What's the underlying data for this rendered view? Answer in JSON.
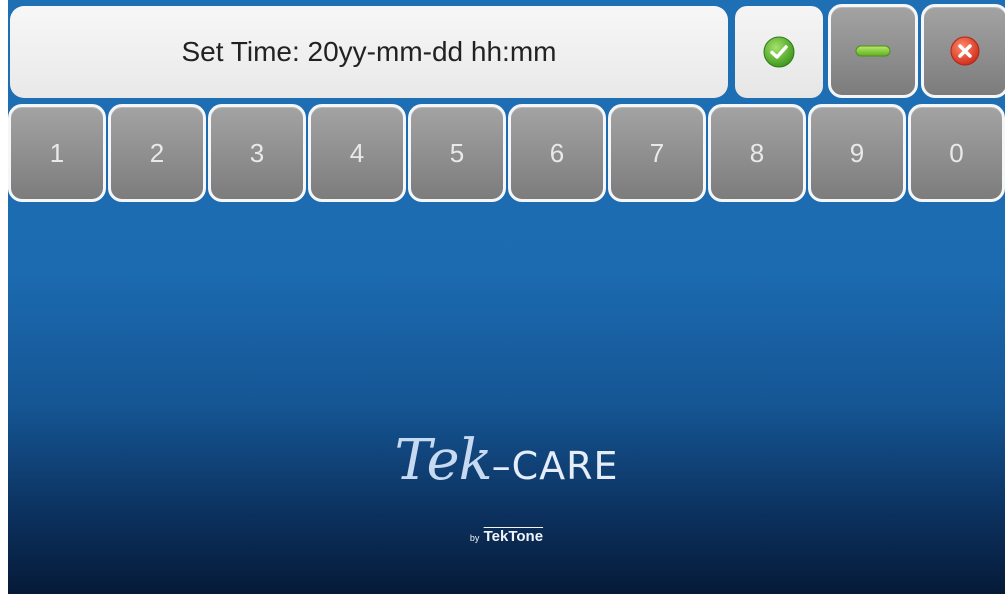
{
  "display": {
    "text": "Set Time: 20yy-mm-dd hh:mm"
  },
  "buttons": {
    "confirm": {
      "icon": "check-icon"
    },
    "backspace": {
      "icon": "minus-icon"
    },
    "cancel": {
      "icon": "close-icon"
    }
  },
  "keypad": {
    "keys": [
      "1",
      "2",
      "3",
      "4",
      "5",
      "6",
      "7",
      "8",
      "9",
      "0"
    ]
  },
  "logo": {
    "tek": "Tek",
    "dash": "–",
    "care": "CARE",
    "by": "by",
    "brand": "TekTone"
  },
  "colors": {
    "background_top": "#1f6fb5",
    "background_bottom": "#061a38",
    "key_gray": "#8e8e8e",
    "confirm_green": "#5cb82c",
    "cancel_red": "#e0402f"
  }
}
